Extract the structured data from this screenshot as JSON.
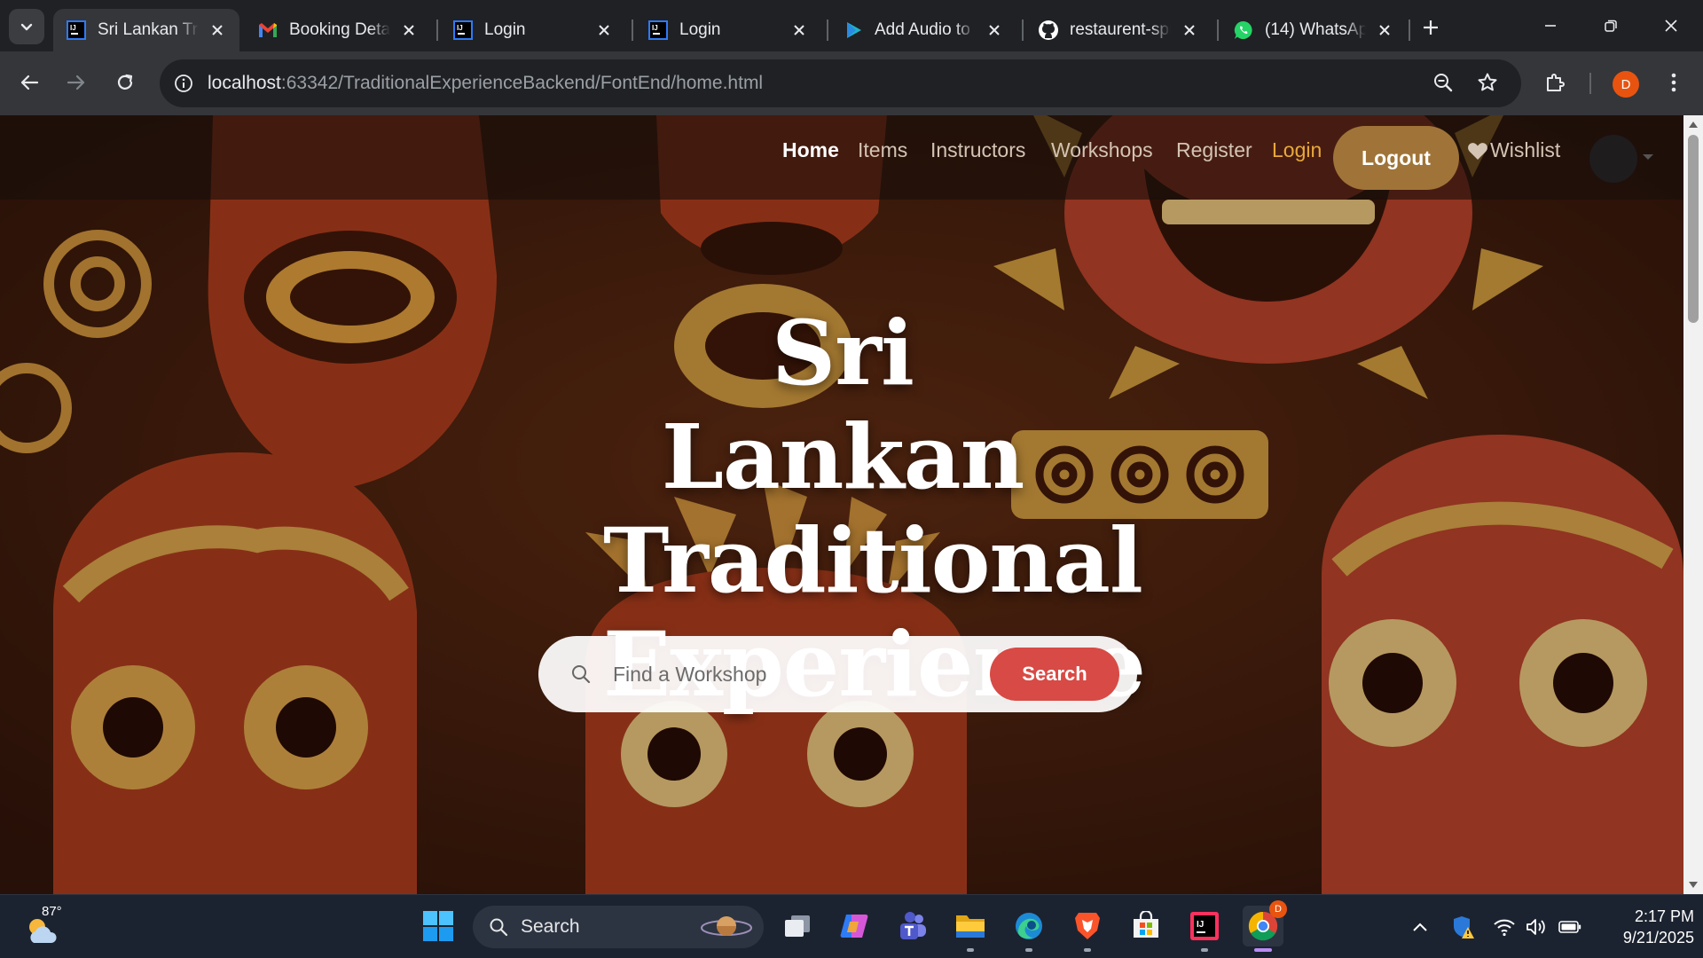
{
  "browser": {
    "tabs": [
      {
        "title": "Sri Lankan Tra",
        "favicon": "intellij-icon",
        "active": true
      },
      {
        "title": "Booking Detai",
        "favicon": "gmail-icon",
        "active": false
      },
      {
        "title": "Login",
        "favicon": "intellij-icon",
        "active": false
      },
      {
        "title": "Login",
        "favicon": "intellij-icon",
        "active": false
      },
      {
        "title": "Add Audio to",
        "favicon": "play-icon",
        "active": false
      },
      {
        "title": "restaurent-spr",
        "favicon": "github-icon",
        "active": false
      },
      {
        "title": "(14) WhatsApp",
        "favicon": "whatsapp-icon",
        "active": false
      }
    ],
    "url_host": "localhost",
    "url_path": ":63342/TraditionalExperienceBackend/FontEnd/home.html",
    "profile_initial": "D"
  },
  "site": {
    "nav": {
      "home": "Home",
      "items": "Items",
      "instructors": "Instructors",
      "workshops": "Workshops",
      "register": "Register",
      "login": "Login",
      "logout": "Logout",
      "wishlist": "Wishlist"
    },
    "hero": {
      "title_line1": "Sri Lankan",
      "title_line2": "Traditional",
      "title_line3": "Experience",
      "search_placeholder": "Find a Workshop",
      "search_button": "Search"
    }
  },
  "taskbar": {
    "weather_temp": "87°",
    "search_label": "Search",
    "time": "2:17 PM",
    "date": "9/21/2025"
  },
  "colors": {
    "accent_gold": "#a07438",
    "login_color": "#e9a93b",
    "search_button": "#d84a45"
  }
}
